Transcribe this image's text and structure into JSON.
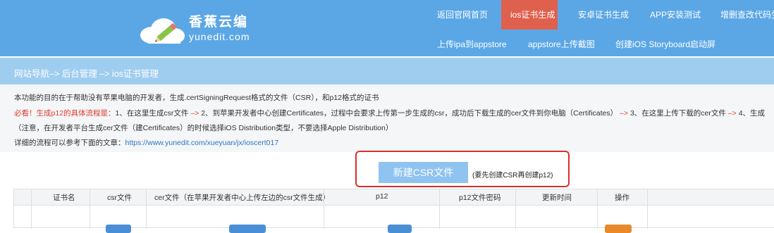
{
  "brand": {
    "name": "香蕉云编",
    "domain": "yunedit.com"
  },
  "nav": {
    "row1": [
      "返回官网首页",
      "ios证书生成",
      "安卓证书生成",
      "APP安装测试",
      "增删查改代码生"
    ],
    "row2": [
      "上传ipa到appstore",
      "appstore上传截图",
      "创建iOS Storyboard启动屏"
    ],
    "active": "ios证书生成"
  },
  "breadcrumb": "网站导航–> 后台管理 –> ios证书管理",
  "intro": {
    "line1": "本功能的目的在于帮助没有苹果电脑的开发者，生成.certSigningRequest格式的文件（CSR），和p12格式的证书",
    "line2_prefix": "必看！生成p12的具体流程是：",
    "line2_step1": "1、在这里生成csr文件",
    "arrow": " –> ",
    "line2_step2": "2、到苹果开发者中心创建Certificates，过程中会要求上传第一步生成的csr，成功后下载生成的cer文件到你电脑（Certificates）",
    "line2_step3": "3、在这里上传下载的cer文件",
    "line2_step4": "4、生成",
    "line3": "（注意，在开发者平台生成cer文件（建Certificates）的时候选择iOS Distribution类型，不要选择Apple Distribution）",
    "line4_prefix": "详细的流程可以参考下面的文章：",
    "line4_link": "https://www.yunedit.com/xueyuan/jx/ioscert017"
  },
  "action": {
    "new_csr": "新建CSR文件",
    "hint": "(要先创建CSR再创建p12)"
  },
  "table": {
    "headers": [
      "证书名",
      "csr文件",
      "cer文件（在苹果开发者中心上传左边的csr文件生成）",
      "p12",
      "p12文件密码",
      "更新时间",
      "操作"
    ]
  },
  "colors": {
    "header_bg": "#5ba7e6",
    "active_tab": "#e0604e",
    "breadcrumb_bg": "#9fcdf0",
    "button": "#8fc3f0",
    "highlight_border": "#d9302a",
    "warn_red": "#e03c2c",
    "link": "#2f74c0"
  }
}
